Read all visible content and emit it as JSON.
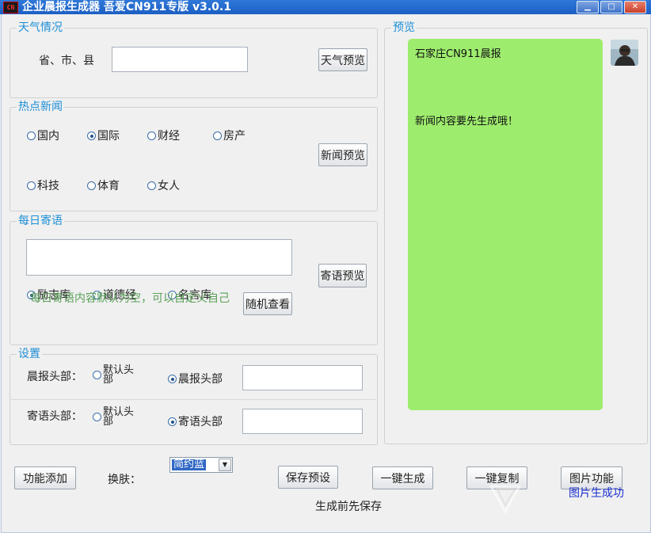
{
  "window": {
    "title": "企业晨报生成器  吾爱CN911专版 v3.0.1",
    "icon_name": "app-logo-icon",
    "controls": {
      "minimize": "▁",
      "maximize": "□",
      "close": "✕"
    }
  },
  "weather": {
    "group_title": "天气情况",
    "region_label": "省、市、县",
    "region_value": "",
    "preview_button": "天气预览"
  },
  "news": {
    "group_title": "热点新闻",
    "options": [
      {
        "label": "国内",
        "checked": false
      },
      {
        "label": "国际",
        "checked": true
      },
      {
        "label": "财经",
        "checked": false
      },
      {
        "label": "房产",
        "checked": false
      },
      {
        "label": "科技",
        "checked": false
      },
      {
        "label": "体育",
        "checked": false
      },
      {
        "label": "女人",
        "checked": false
      }
    ],
    "preview_button": "新闻预览"
  },
  "daily_quote": {
    "group_title": "每日寄语",
    "text_value": "",
    "preview_button": "寄语预览",
    "sources": [
      {
        "label": "励志库",
        "checked": true
      },
      {
        "label": "道德经",
        "checked": false
      },
      {
        "label": "名言库",
        "checked": false
      }
    ],
    "random_button": "随机查看",
    "hint": "每日寄语内容默认为空，可以自定义自己"
  },
  "settings": {
    "group_title": "设置",
    "header_rows": [
      {
        "label": "晨报头部：",
        "default_option": "默认头部",
        "custom_option": "晨报头部",
        "custom_checked": true,
        "value": ""
      },
      {
        "label": "寄语头部：",
        "default_option": "默认头部",
        "custom_option": "寄语头部",
        "custom_checked": true,
        "value": ""
      }
    ]
  },
  "preview": {
    "group_title": "预览",
    "title": "石家庄CN911晨报",
    "message": "新闻内容要先生成哦！",
    "bubble_color": "#9eec6e"
  },
  "footer": {
    "add_button": "功能添加",
    "skin_label": "换肤：",
    "skin_selected": "简约蓝",
    "save_button": "保存预设",
    "generate_button": "一键生成",
    "copy_button": "一键复制",
    "image_button": "图片功能",
    "note": "生成前先保存",
    "status": "图片生成功"
  },
  "colors": {
    "titlebar": "#1d5fc4",
    "group_title": "#1e8fd6",
    "hint": "#5aa058",
    "status": "#1a2fd0"
  }
}
